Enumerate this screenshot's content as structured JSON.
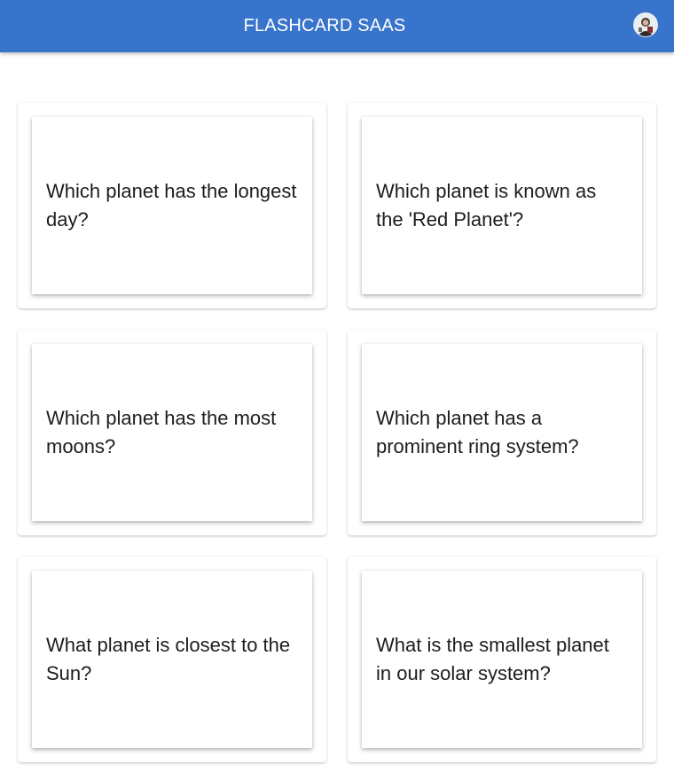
{
  "header": {
    "title": "FLASHCARD SAAS",
    "bar_color": "#3874cb",
    "avatar_icon": "user-avatar-icon"
  },
  "flashcards": [
    {
      "question": "Which planet has the longest day?"
    },
    {
      "question": "Which planet is known as the 'Red Planet'?"
    },
    {
      "question": "Which planet has the most moons?"
    },
    {
      "question": "Which planet has a prominent ring system?"
    },
    {
      "question": "What planet is closest to the Sun?"
    },
    {
      "question": "What is the smallest planet in our solar system?"
    }
  ]
}
